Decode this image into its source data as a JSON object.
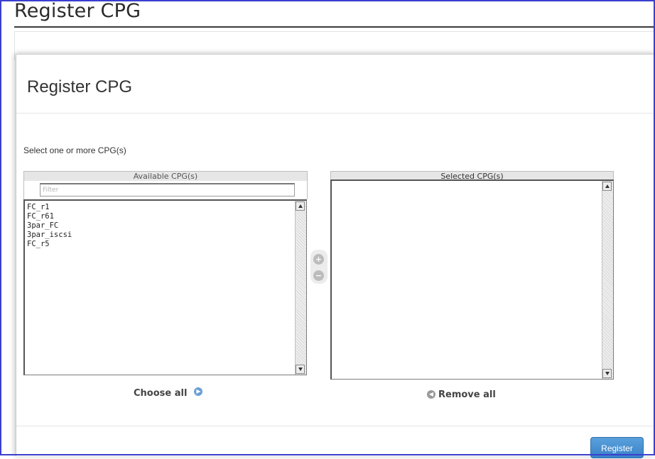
{
  "page": {
    "title": "Register CPG"
  },
  "modal": {
    "title": "Register CPG",
    "instruction": "Select one or more CPG(s)",
    "available": {
      "header": "Available CPG(s)",
      "filter_placeholder": "Filter",
      "items": [
        "FC_r1",
        "FC_r61",
        "3par_FC",
        "3par_iscsi",
        "FC_r5"
      ]
    },
    "selected": {
      "header": "Selected CPG(s)",
      "items": []
    },
    "choose_all_label": "Choose all",
    "remove_all_label": "Remove all",
    "register_label": "Register"
  },
  "icons": {
    "add": "plus-circle-icon",
    "remove": "minus-circle-icon",
    "choose_all": "right-arrow-circle-icon",
    "remove_all": "left-arrow-circle-icon"
  },
  "colors": {
    "primary_button": "#3a82c8",
    "arrow_blue": "#6a9fd6",
    "window_border": "#3a3fcf"
  }
}
